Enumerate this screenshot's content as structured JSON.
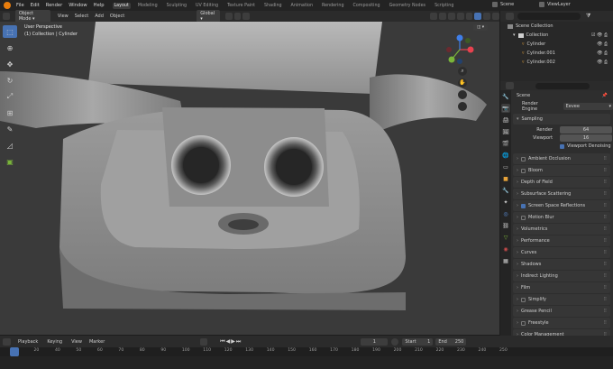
{
  "topbar": {
    "menus": [
      "File",
      "Edit",
      "Render",
      "Window",
      "Help"
    ],
    "workspaces": [
      "Layout",
      "Modeling",
      "Sculpting",
      "UV Editing",
      "Texture Paint",
      "Shading",
      "Animation",
      "Rendering",
      "Compositing",
      "Geometry Nodes",
      "Scripting"
    ],
    "active_workspace": "Layout",
    "scene": "Scene",
    "view_layer": "ViewLayer"
  },
  "viewport_header": {
    "mode": "Object Mode",
    "menus": [
      "View",
      "Select",
      "Add",
      "Object"
    ],
    "transform": "Global"
  },
  "viewport": {
    "view_name": "User Perspective",
    "collection_info": "(1) Collection | Cylinder",
    "gizmo": {
      "x": "X",
      "y": "Y",
      "z": "Z"
    }
  },
  "outliner": {
    "root": "Scene Collection",
    "collection": "Collection",
    "objects": [
      "Cylinder",
      "Cylinder.001",
      "Cylinder.002"
    ]
  },
  "properties": {
    "search_label": "Scene",
    "render_engine_label": "Render Engine",
    "render_engine": "Eevee",
    "sampling": "Sampling",
    "render_label": "Render",
    "render_value": "64",
    "viewport_label": "Viewport",
    "viewport_value": "16",
    "viewport_denoising": "Viewport Denoising",
    "panels": [
      {
        "label": "Ambient Occlusion",
        "checkbox": true,
        "checked": false
      },
      {
        "label": "Bloom",
        "checkbox": true,
        "checked": false
      },
      {
        "label": "Depth of Field",
        "checkbox": false,
        "checked": false
      },
      {
        "label": "Subsurface Scattering",
        "checkbox": false,
        "checked": false
      },
      {
        "label": "Screen Space Reflections",
        "checkbox": true,
        "checked": true
      },
      {
        "label": "Motion Blur",
        "checkbox": true,
        "checked": false
      },
      {
        "label": "Volumetrics",
        "checkbox": false,
        "checked": false
      },
      {
        "label": "Performance",
        "checkbox": false,
        "checked": false
      },
      {
        "label": "Curves",
        "checkbox": false,
        "checked": false
      },
      {
        "label": "Shadows",
        "checkbox": false,
        "checked": false
      },
      {
        "label": "Indirect Lighting",
        "checkbox": false,
        "checked": false
      },
      {
        "label": "Film",
        "checkbox": false,
        "checked": false
      },
      {
        "label": "Simplify",
        "checkbox": true,
        "checked": false
      },
      {
        "label": "Grease Pencil",
        "checkbox": false,
        "checked": false
      },
      {
        "label": "Freestyle",
        "checkbox": true,
        "checked": false
      },
      {
        "label": "Color Management",
        "checkbox": false,
        "checked": false
      }
    ]
  },
  "timeline": {
    "menus": [
      "Playback",
      "Keying",
      "View",
      "Marker"
    ],
    "current_frame": "1",
    "start_label": "Start",
    "start": "1",
    "end_label": "End",
    "end": "250",
    "ruler": [
      "1",
      "20",
      "40",
      "50",
      "60",
      "70",
      "80",
      "90",
      "100",
      "110",
      "120",
      "130",
      "140",
      "150",
      "160",
      "170",
      "180",
      "190",
      "200",
      "210",
      "220",
      "230",
      "240",
      "250"
    ]
  },
  "colors": {
    "accent": "#4772b3",
    "axis_x": "#e8424f",
    "axis_y": "#7ab53a",
    "axis_z": "#3f7ee8",
    "mesh": "#a6a6a6"
  }
}
